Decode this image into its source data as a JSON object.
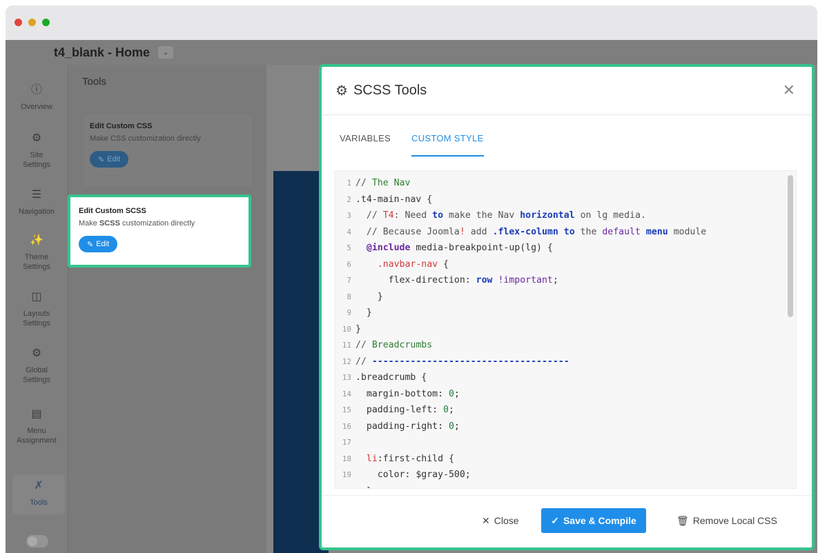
{
  "window": {
    "traffic_lights": [
      "#e0443e",
      "#dea123",
      "#1aab29"
    ]
  },
  "page": {
    "title": "t4_blank - Home"
  },
  "rail": {
    "items": [
      {
        "icon": "info-icon",
        "label": "Overview"
      },
      {
        "icon": "gears-icon",
        "label": "Site Settings"
      },
      {
        "icon": "menu-icon",
        "label": "Navigation"
      },
      {
        "icon": "magic-wand-icon",
        "label": "Theme Settings"
      },
      {
        "icon": "columns-icon",
        "label": "Layouts Settings"
      },
      {
        "icon": "gears-icon",
        "label": "Global Settings"
      },
      {
        "icon": "list-icon",
        "label": "Menu Assignment"
      },
      {
        "icon": "tools-icon",
        "label": "Tools"
      }
    ]
  },
  "tools": {
    "title": "Tools",
    "cards": [
      {
        "title": "Edit Custom CSS",
        "desc_pre": "Make ",
        "desc_bold": "CSS",
        "desc_post": " customization directly",
        "button": "Edit"
      },
      {
        "title": "Edit Custom SCSS",
        "desc_pre": "Make ",
        "desc_bold": "SCSS",
        "desc_post": " customization directly",
        "button": "Edit"
      }
    ]
  },
  "modal": {
    "title": "SCSS Tools",
    "tabs": [
      "VARIABLES",
      "CUSTOM STYLE"
    ],
    "active_tab": "CUSTOM STYLE",
    "footer": {
      "close": "Close",
      "save": "Save & Compile",
      "remove": "Remove Local CSS"
    }
  },
  "editor": {
    "lines": [
      [
        [
          "c-cmt",
          "// "
        ],
        [
          "c-cmt-g",
          "The Nav"
        ]
      ],
      [
        [
          "",
          ".t4-main-nav {"
        ]
      ],
      [
        [
          "c-cmt",
          "  // "
        ],
        [
          "c-red",
          "T4"
        ],
        [
          "c-cmt",
          ": Need "
        ],
        [
          "c-kw",
          "to"
        ],
        [
          "c-cmt",
          " make the Nav "
        ],
        [
          "c-kw",
          "horizontal"
        ],
        [
          "c-cmt",
          " on lg media."
        ]
      ],
      [
        [
          "c-cmt",
          "  // Because Joomla"
        ],
        [
          "c-red",
          "!"
        ],
        [
          "c-cmt",
          " add "
        ],
        [
          "c-kw",
          ".flex-column"
        ],
        [
          "c-cmt",
          " "
        ],
        [
          "c-kw",
          "to"
        ],
        [
          "c-cmt",
          " the "
        ],
        [
          "c-purple",
          "default"
        ],
        [
          "c-cmt",
          " "
        ],
        [
          "c-kw",
          "menu"
        ],
        [
          "c-cmt",
          " module"
        ]
      ],
      [
        [
          "",
          "  "
        ],
        [
          "c-at",
          "@include"
        ],
        [
          "",
          " media-breakpoint-up(lg) {"
        ]
      ],
      [
        [
          "",
          "    "
        ],
        [
          "c-red",
          ".navbar-nav"
        ],
        [
          "",
          " {"
        ]
      ],
      [
        [
          "",
          "      flex-direction: "
        ],
        [
          "c-kw",
          "row"
        ],
        [
          "",
          " "
        ],
        [
          "c-purple",
          "!important"
        ],
        [
          "",
          ";"
        ]
      ],
      [
        [
          "",
          "    }"
        ]
      ],
      [
        [
          "",
          "  }"
        ]
      ],
      [
        [
          "",
          "}"
        ]
      ],
      [
        [
          "c-cmt",
          "// "
        ],
        [
          "c-cmt-g",
          "Breadcrumbs"
        ]
      ],
      [
        [
          "c-cmt",
          "// "
        ],
        [
          "c-kw",
          "------------------------------------"
        ]
      ],
      [
        [
          "",
          ".breadcrumb {"
        ]
      ],
      [
        [
          "",
          "  margin-bottom: "
        ],
        [
          "c-num",
          "0"
        ],
        [
          "",
          ";"
        ]
      ],
      [
        [
          "",
          "  padding-left: "
        ],
        [
          "c-num",
          "0"
        ],
        [
          "",
          ";"
        ]
      ],
      [
        [
          "",
          "  padding-right: "
        ],
        [
          "c-num",
          "0"
        ],
        [
          "",
          ";"
        ]
      ],
      [
        [
          "",
          ""
        ]
      ],
      [
        [
          "",
          "  "
        ],
        [
          "c-red",
          "li"
        ],
        [
          "",
          ":first-child {"
        ]
      ],
      [
        [
          "",
          "    color: $gray-500;"
        ]
      ],
      [
        [
          "",
          "  }"
        ]
      ]
    ]
  }
}
